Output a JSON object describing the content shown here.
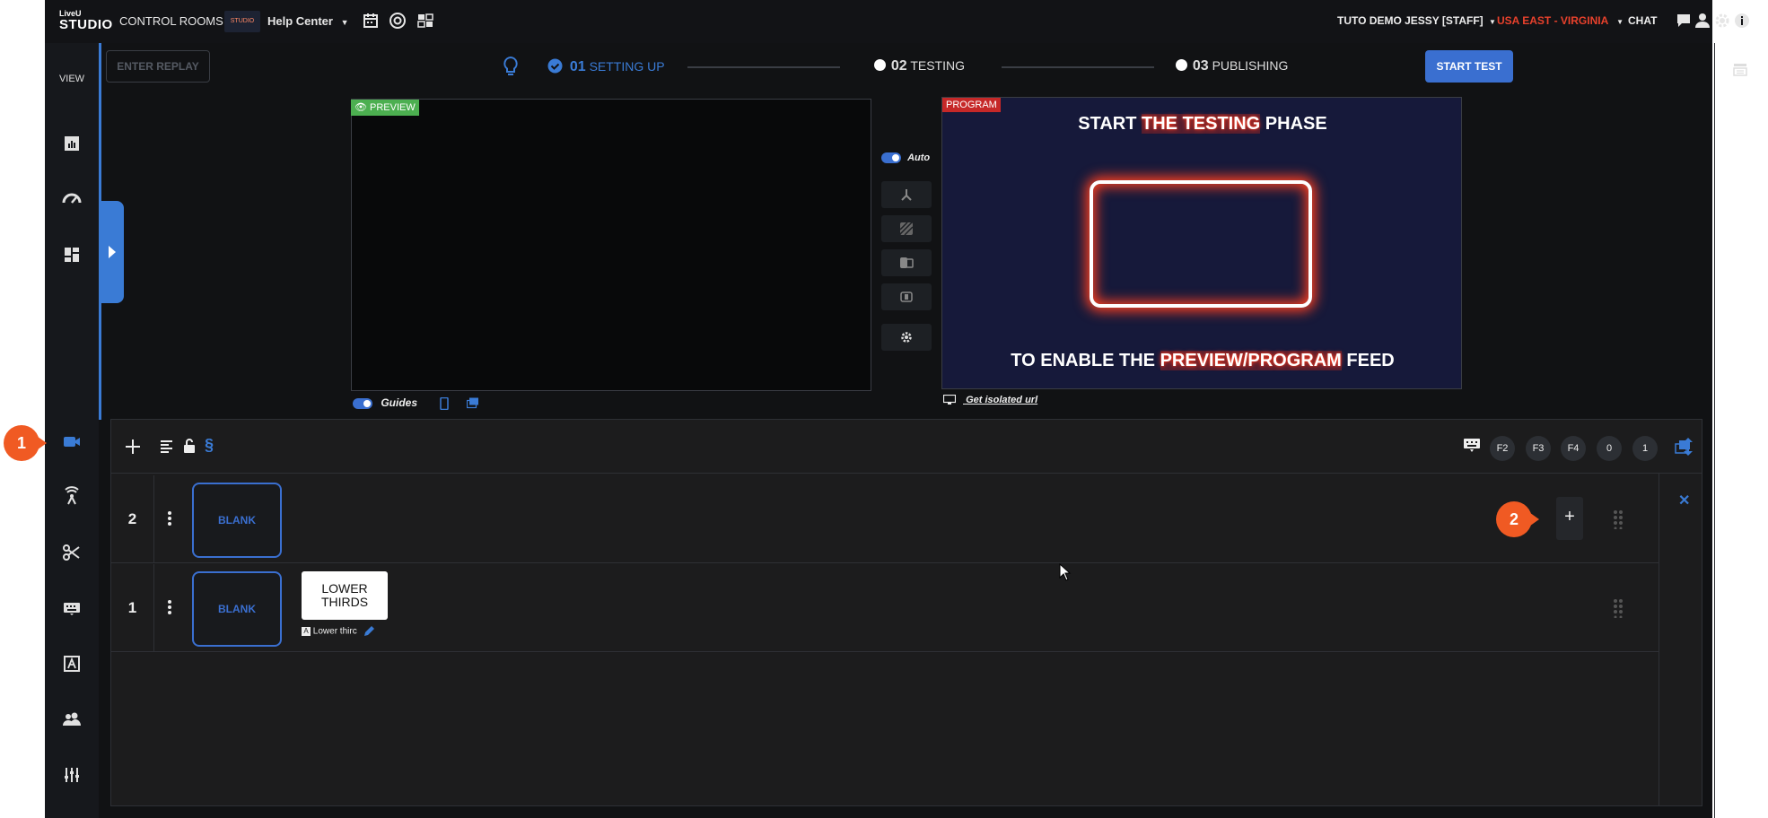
{
  "topbar": {
    "logo_line1": "LiveU",
    "logo_line2": "STUDIO",
    "control_rooms": "CONTROL ROOMS",
    "mini_logo": "STUDIO",
    "help_center": "Help Center",
    "account": "TUTO DEMO JESSY [STAFF]",
    "region": "USA EAST - VIRGINIA",
    "chat": "CHAT"
  },
  "rail": {
    "view_label": "VIEW"
  },
  "stepbar": {
    "enter_replay": "ENTER REPLAY",
    "step1_num": "01",
    "step1_label": "SETTING UP",
    "step2_num": "02",
    "step2_label": "TESTING",
    "step3_num": "03",
    "step3_label": "PUBLISHING",
    "start_test": "START TEST"
  },
  "preview": {
    "tag": "PREVIEW",
    "guides_label": "Guides"
  },
  "controls": {
    "auto_label": "Auto"
  },
  "program": {
    "tag": "PROGRAM",
    "headline_a": "START ",
    "headline_hl": "THE TESTING",
    "headline_b": " PHASE",
    "footer_a": "TO ENABLE THE ",
    "footer_hl": "PREVIEW/PROGRAM",
    "footer_b": " FEED",
    "isolated_url": "Get isolated url"
  },
  "panel": {
    "fkeys": [
      "F2",
      "F3",
      "F4",
      "0",
      "1"
    ],
    "layers": [
      {
        "num": "2",
        "blank": "BLANK"
      },
      {
        "num": "1",
        "blank": "BLANK",
        "overlay_line1": "LOWER",
        "overlay_line2": "THIRDS",
        "overlay_label": "Lower thirc"
      }
    ]
  },
  "callouts": {
    "one": "1",
    "two": "2"
  },
  "colors": {
    "accent": "#3a6fd0",
    "region": "#e8412c",
    "callout": "#f05a23",
    "preview_tag": "#4caf50",
    "program_tag": "#c62828"
  }
}
